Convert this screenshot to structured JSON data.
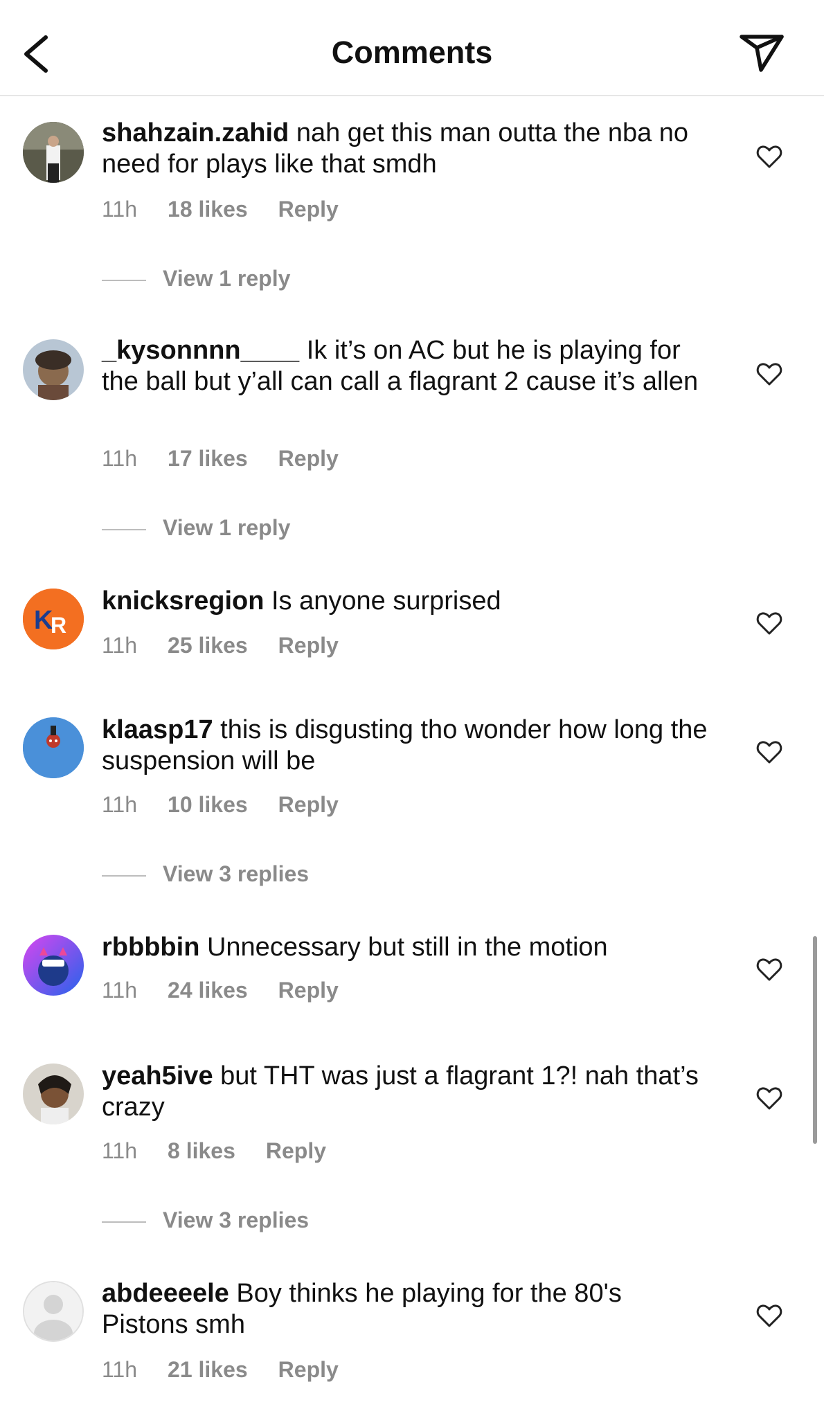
{
  "header": {
    "title": "Comments"
  },
  "comments": [
    {
      "username": "shahzain.zahid",
      "text": "nah get this man outta the nba no need for plays like that smdh",
      "time": "11h",
      "likes": "18 likes",
      "reply": "Reply",
      "view_replies": "View 1 reply"
    },
    {
      "username": "_kysonnnn____",
      "text": "Ik it’s on AC but he is playing for the ball but y’all can call a flagrant 2 cause it’s allen",
      "time": "11h",
      "likes": "17 likes",
      "reply": "Reply",
      "view_replies": "View 1 reply"
    },
    {
      "username": "knicksregion",
      "text": "Is anyone surprised",
      "time": "11h",
      "likes": "25 likes",
      "reply": "Reply",
      "avatar_text": "KR"
    },
    {
      "username": "klaasp17",
      "text": "this is disgusting tho wonder how long the suspension will be",
      "time": "11h",
      "likes": "10 likes",
      "reply": "Reply",
      "view_replies": "View 3 replies"
    },
    {
      "username": "rbbbbin",
      "text": "Unnecessary but still in the motion",
      "time": "11h",
      "likes": "24 likes",
      "reply": "Reply"
    },
    {
      "username": "yeah5ive",
      "text": "but THT was just a flagrant 1?! nah that’s crazy",
      "time": "11h",
      "likes": "8 likes",
      "reply": "Reply",
      "view_replies": "View 3 replies"
    },
    {
      "username": "abdeeeele",
      "text": "Boy thinks he playing for the 80's Pistons smh",
      "time": "11h",
      "likes": "21 likes",
      "reply": "Reply"
    }
  ],
  "colors": {
    "meta_gray": "#8a8a8a",
    "knicks_orange": "#f36f21",
    "klaasp_blue": "#4a90d9"
  },
  "icons": [
    "back-arrow-icon",
    "send-icon",
    "heart-icon"
  ]
}
